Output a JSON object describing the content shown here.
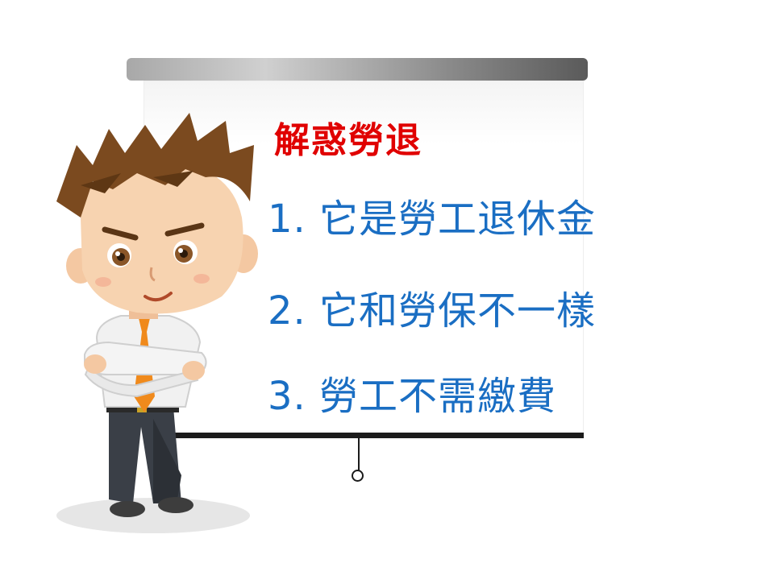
{
  "slide": {
    "title": "解惑勞退",
    "items": [
      "1. 它是勞工退休金",
      "2. 它和勞保不一樣",
      "3. 勞工不需繳費"
    ]
  },
  "colors": {
    "title": "#e00000",
    "items": "#1a6ec3",
    "background": "#ffffff"
  },
  "icons": {
    "character": "cartoon-businessman-illustration",
    "projector": "projection-screen"
  }
}
